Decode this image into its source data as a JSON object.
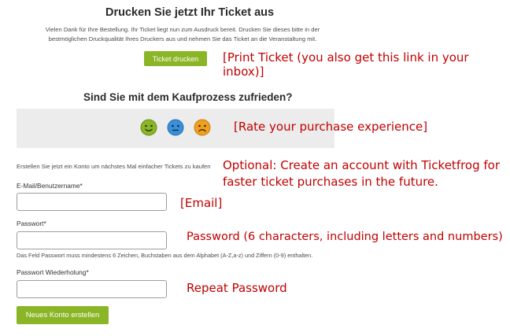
{
  "print_section": {
    "title": "Drucken Sie jetzt Ihr Ticket aus",
    "text_line1": "Vielen Dank für Ihre Bestellung. Ihr Ticket liegt nun zum Ausdruck bereit. Drucken Sie dieses bitte in der",
    "text_line2": "bestmöglichen Druckqualität Ihres Druckers aus und nehmen Sie das Ticket an die Veranstaltung mit.",
    "button_label": "Ticket drucken",
    "annotation": "[Print Ticket (you also get this link in your inbox)]"
  },
  "rating_section": {
    "title": "Sind Sie mit dem Kaufprozess zufrieden?",
    "faces": [
      {
        "icon": "happy-face-icon",
        "color": "#8ab526"
      },
      {
        "icon": "neutral-face-icon",
        "color": "#3a8fd8"
      },
      {
        "icon": "sad-face-icon",
        "color": "#f0a020"
      }
    ],
    "annotation": "[Rate your purchase experience]"
  },
  "account_section": {
    "intro": "Erstellen Sie jetzt ein Konto um nächstes Mal einfacher Tickets zu kaufen",
    "annotation_line1": "Optional: Create an account with Ticketfrog for",
    "annotation_line2": "faster ticket purchases in the future.",
    "email_label": "E-Mail/Benutzername*",
    "email_annotation": "[Email]",
    "password_label": "Passwort*",
    "password_annotation": "Password (6 characters, including letters and numbers)",
    "password_hint": "Das Feld Passwort muss mindestens 6 Zeichen, Buchstaben aus dem Alphabet (A-Z,a-z) und Ziffern (0-9) enthalten.",
    "repeat_label": "Passwort Wiederholung*",
    "repeat_annotation": "Repeat Password",
    "button_label": "Neues Konto erstellen"
  },
  "colors": {
    "accent_green": "#8ab526",
    "annotation_red": "#c00000"
  }
}
